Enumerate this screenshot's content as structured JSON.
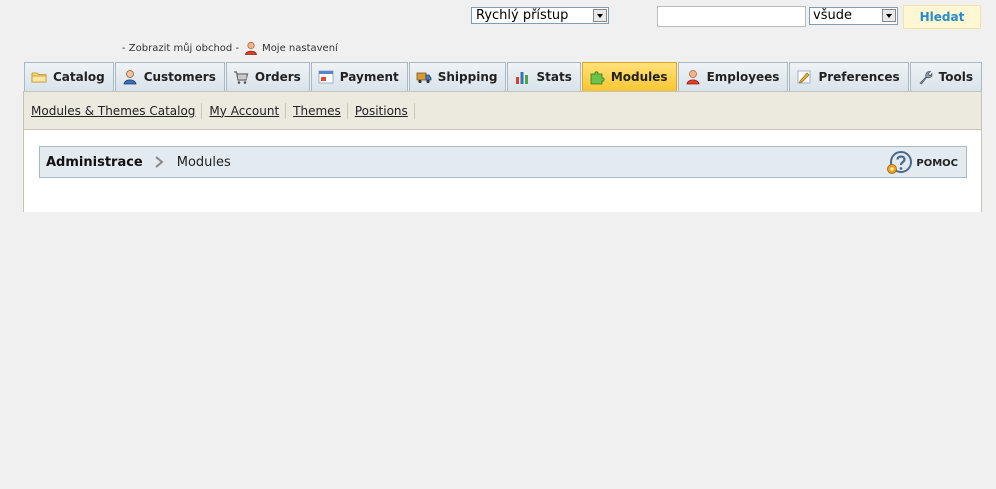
{
  "header": {
    "quick_access": "Rychlý přístup",
    "search_value": "",
    "search_scope": "všude",
    "search_button": "Hledat",
    "view_shop": "- Zobrazit můj obchod -",
    "my_settings": "Moje nastavení"
  },
  "tabs": [
    {
      "label": "Catalog",
      "icon": "folder-icon"
    },
    {
      "label": "Customers",
      "icon": "customer-icon"
    },
    {
      "label": "Orders",
      "icon": "cart-icon"
    },
    {
      "label": "Payment",
      "icon": "payment-icon"
    },
    {
      "label": "Shipping",
      "icon": "truck-icon"
    },
    {
      "label": "Stats",
      "icon": "chart-icon"
    },
    {
      "label": "Modules",
      "icon": "puzzle-icon",
      "active": true
    },
    {
      "label": "Employees",
      "icon": "employee-icon"
    },
    {
      "label": "Preferences",
      "icon": "preferences-icon"
    },
    {
      "label": "Tools",
      "icon": "wrench-icon"
    }
  ],
  "subtabs": [
    "Modules & Themes Catalog",
    "My Account",
    "Themes",
    "Positions"
  ],
  "breadcrumb": {
    "root": "Administrace",
    "current": "Modules"
  },
  "help_label": "POMOC",
  "colors": {
    "active_tab": "#fcc631",
    "search_button_text": "#268ccd"
  }
}
